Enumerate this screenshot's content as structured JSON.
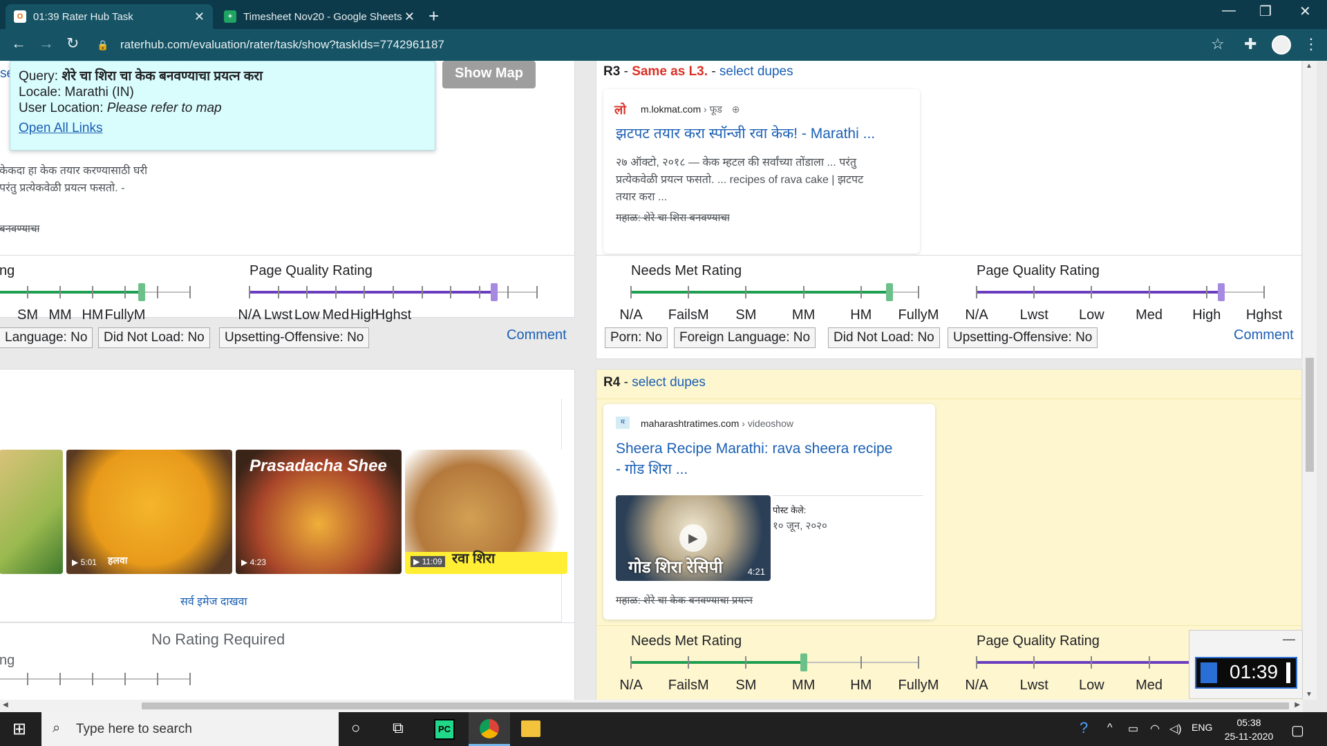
{
  "browser": {
    "tabs": [
      {
        "title": "01:39 Rater Hub Task",
        "favicon": "O"
      },
      {
        "title": "Timesheet Nov20 - Google Sheets",
        "favicon": "+"
      }
    ],
    "new_tab": "+",
    "url": "raterhub.com/evaluation/rater/task/show?taskIds=7742961187"
  },
  "query": {
    "query_label": "Query: ",
    "query_value": "शेरे चा शिरा चा केक बनवण्याचा प्रयत्न करा",
    "locale_label": "Locale: Marathi (IN)",
    "user_location_label": "User Location: ",
    "user_location_value": "Please refer to map",
    "open_all_links": "Open All Links",
    "show_map": "Show Map",
    "side_fragment": "se"
  },
  "left": {
    "snippet1": "केकदा हा केक तयार करण्यासाठी घरी",
    "snippet2": "परंतु प्रत्येकवेळी प्रयत्न फसतो. -",
    "strike": "बनवण्याचा",
    "ng": "ng",
    "pqr_title": "Page Quality Rating",
    "nm_labels": [
      "SM",
      "MM",
      "HM",
      "FullyM"
    ],
    "pq_labels": [
      "N/A",
      "Lwst",
      "Low",
      "Med",
      "High",
      "Hghst"
    ],
    "flags": [
      "Language: No",
      "Did Not Load: No",
      "Upsetting-Offensive: No"
    ],
    "comment": "Comment",
    "images": [
      {
        "duration": "",
        "caption": ""
      },
      {
        "duration": "▶ 5:01",
        "caption": "हलवा"
      },
      {
        "duration": "▶ 4:23",
        "caption": "Prasadacha Shee"
      },
      {
        "duration": "▶ 11:09",
        "caption": "रवा शिरा"
      }
    ],
    "see_all_images": "सर्व इमेज दाखवा",
    "no_rating": "No Rating Required",
    "ng2": "ng"
  },
  "r3": {
    "id": "R3",
    "same_as": "Same as L3.",
    "select_dupes": "select dupes",
    "site": "m.lokmat.com",
    "site_path": " › फूड",
    "title": "झटपट तयार करा स्पॉन्जी रवा केक! - Marathi ...",
    "snippet1": "२७ ऑक्टो, २०१८ — केक म्हटल की सर्वांच्या तोंडाला ... परंतु",
    "snippet2": "प्रत्येकवेळी प्रयत्न फसतो. ... recipes of rava cake | झटपट",
    "snippet3": "तयार करा ...",
    "strike": "गहाळ: शेरे चा शिरा बनवण्याचा",
    "nmr_title": "Needs Met Rating",
    "pqr_title": "Page Quality Rating",
    "nm_labels": [
      "N/A",
      "FailsM",
      "SM",
      "MM",
      "HM",
      "FullyM"
    ],
    "pq_labels": [
      "N/A",
      "Lwst",
      "Low",
      "Med",
      "High",
      "Hghst"
    ],
    "flags": [
      "Porn: No",
      "Foreign Language: No",
      "Did Not Load: No",
      "Upsetting-Offensive: No"
    ],
    "comment": "Comment",
    "nm_value": 4.5,
    "pq_value": 4.25
  },
  "r4": {
    "id": "R4",
    "select_dupes": "select dupes",
    "site": "maharashtratimes.com",
    "site_path": " › videoshow",
    "title1": "Sheera Recipe Marathi: rava sheera recipe",
    "title2": "- गोड शिरा ...",
    "posted_label": "पोस्ट केले:",
    "posted_date": "१० जून, २०२०",
    "thumb_caption": "गोड शिरा रेसिपी",
    "thumb_duration": "4:21",
    "strike": "गहाळ: शेरे चा केक बनवण्याचा प्रयत्न",
    "nmr_title": "Needs Met Rating",
    "pqr_title": "Page Quality Rating",
    "nm_labels": [
      "N/A",
      "FailsM",
      "SM",
      "MM",
      "HM",
      "FullyM"
    ],
    "pq_labels": [
      "N/A",
      "Lwst",
      "Low",
      "Med",
      "High",
      "Hghst"
    ],
    "nm_value": 3,
    "pq_value": 4
  },
  "timer": {
    "value": "01:39"
  },
  "taskbar": {
    "search_placeholder": "Type here to search",
    "lang": "ENG",
    "time": "05:38",
    "date": "25-11-2020"
  },
  "colors": {
    "needs_met": "#1e9e50",
    "page_quality": "#6a3dbf"
  }
}
